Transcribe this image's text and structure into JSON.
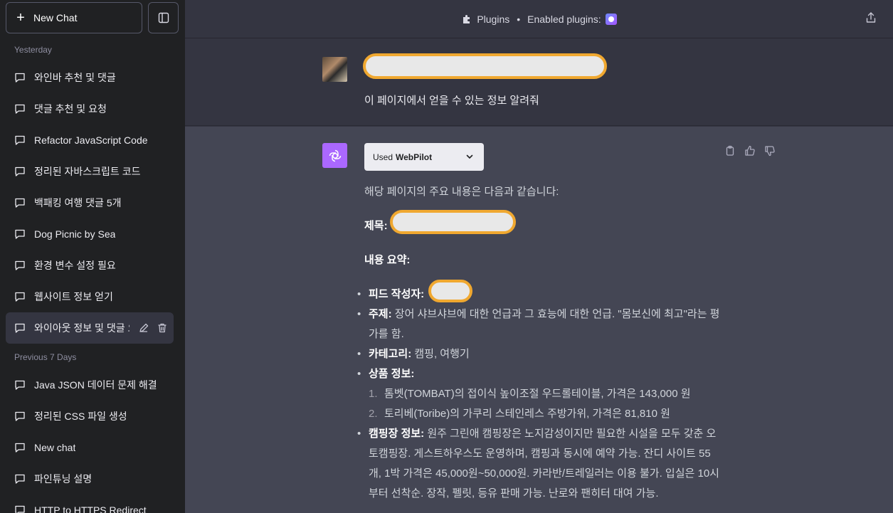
{
  "sidebar": {
    "new_chat_label": "New Chat",
    "section_yesterday": "Yesterday",
    "section_prev7": "Previous 7 Days",
    "yesterday_items": [
      "와인바 추천 및 댓글",
      "댓글 추천 및 요청",
      "Refactor JavaScript Code",
      "정리된 자바스크립트 코드",
      "백패킹 여행 댓글 5개",
      "Dog Picnic by Sea",
      "환경 변수 설정 필요",
      "웹사이트 정보 얻기",
      "와이아웃 정보 및 댓글 요"
    ],
    "prev7_items": [
      "Java JSON 데이터 문제 해결",
      "정리된 CSS 파일 생성",
      "New chat",
      "파인튜닝 설명",
      "HTTP to HTTPS Redirect"
    ]
  },
  "header": {
    "mode_label": "Plugins",
    "separator": "•",
    "enabled_label": "Enabled plugins:"
  },
  "user_message": {
    "text": "이 페이지에서 얻을 수 있는 정보 알려줘"
  },
  "assistant": {
    "used_prefix": "Used",
    "used_plugin": "WebPilot",
    "intro": "해당 페이지의 주요 내용은 다음과 같습니다:",
    "title_label": "제목:",
    "summary_label": "내용 요약:",
    "bullets": {
      "author_label": "피드 작성자:",
      "topic_label": "주제:",
      "topic_text": "장어 샤브샤브에 대한 언급과 그 효능에 대한 언급. \"몸보신에 최고\"라는 평가를 함.",
      "category_label": "카테고리:",
      "category_text": "캠핑, 여행기",
      "product_label": "상품 정보:",
      "products": [
        "톰벳(TOMBAT)의 접이식 높이조절 우드롤테이블, 가격은 143,000 원",
        "토리베(Toribe)의 가쿠리 스테인레스 주방가위, 가격은 81,810 원"
      ],
      "camp_label": "캠핑장 정보:",
      "camp_text": "원주 그린애 캠핑장은 노지감성이지만 필요한 시설을 모두 갖춘 오토캠핑장. 게스트하우스도 운영하며, 캠핑과 동시에 예약 가능. 잔디 사이트 55개, 1박 가격은 45,000원~50,000원. 카라반/트레일러는 이용 불가. 입실은 10시부터 선착순. 장작, 펠릿, 등유 판매 가능. 난로와 팬히터 대여 가능."
    }
  },
  "colors": {
    "sidebar_bg": "#202123",
    "main_bg": "#343541",
    "assistant_bg": "#444654",
    "bot_avatar": "#ab68ff",
    "redaction_border": "#f0a830"
  }
}
